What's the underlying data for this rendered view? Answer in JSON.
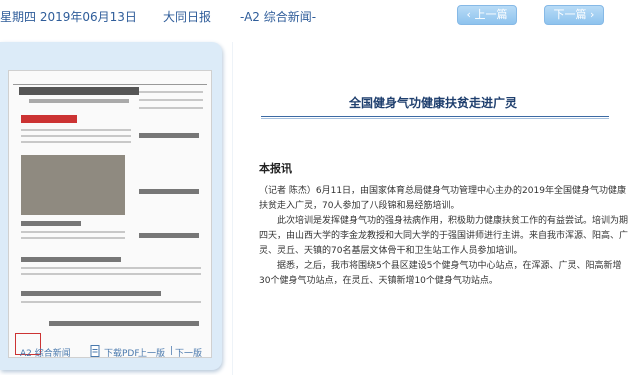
{
  "header": {
    "date": "星期四 2019年06月13日",
    "paper": "大同日报",
    "page": "-A2 综合新闻-",
    "prev_label": "上一篇",
    "next_label": "下一篇",
    "button_color": "#9acbf1"
  },
  "sidebar": {
    "page_label": "A2 综合新闻",
    "pdf_label": "下载PDF",
    "prev_page_label": "上一版",
    "separator": "|",
    "next_page_label": "下一版"
  },
  "article": {
    "title": "全国健身气功健康扶贫走进广灵",
    "dateline": "本报讯",
    "paragraphs": [
      "（记者 陈杰）6月11日，由国家体育总局健身气功管理中心主办的2019年全国健身气功健康扶贫走入广灵，70人参加了八段锦和易经筋培训。",
      "此次培训是发挥健身气功的强身祛病作用，积极助力健康扶贫工作的有益尝试。培训为期四天，由山西大学的李金龙教授和大同大学的于强国讲师进行主讲。来自我市浑源、阳高、广灵、灵丘、天镇的70名基层文体骨干和卫生站工作人员参加培训。",
      "据悉，之后，我市将围绕5个县区建设5个健身气功中心站点，在浑源、广灵、阳高新增30个健身气功站点，在灵丘、天镇新增10个健身气功站点。"
    ]
  },
  "colors": {
    "accent": "#2f5d9a",
    "panel": "#dcebf8",
    "title_rule": "#3c6aa3"
  }
}
